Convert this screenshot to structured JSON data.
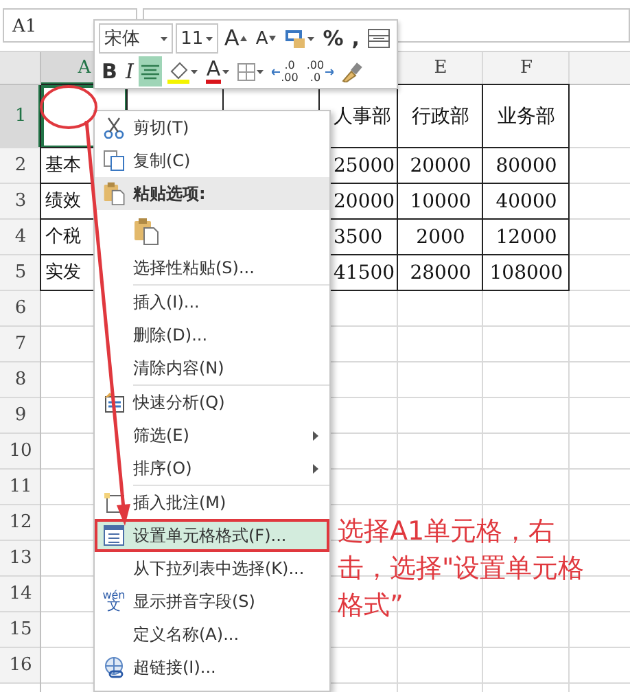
{
  "name_box": {
    "value": "A1"
  },
  "column_headers": {
    "a": {
      "label": "A",
      "selected": true
    },
    "e": {
      "label": "E",
      "selected": false
    },
    "f": {
      "label": "F",
      "selected": false
    }
  },
  "rows": [
    {
      "header": "1",
      "selected": true,
      "d": "人事部",
      "e": "行政部",
      "f": "业务部"
    },
    {
      "header": "2",
      "selected": false,
      "a": "基本",
      "d": "25000",
      "e": "20000",
      "f": "80000"
    },
    {
      "header": "3",
      "selected": false,
      "a": "绩效",
      "d": "20000",
      "e": "10000",
      "f": "40000"
    },
    {
      "header": "4",
      "selected": false,
      "a": "个税",
      "d": "3500",
      "e": "2000",
      "f": "12000"
    },
    {
      "header": "5",
      "selected": false,
      "a": "实发",
      "d": "41500",
      "e": "28000",
      "f": "108000"
    },
    {
      "header": "6",
      "selected": false
    },
    {
      "header": "7",
      "selected": false
    },
    {
      "header": "8",
      "selected": false
    },
    {
      "header": "9",
      "selected": false
    },
    {
      "header": "10",
      "selected": false
    },
    {
      "header": "11",
      "selected": false
    },
    {
      "header": "12",
      "selected": false
    },
    {
      "header": "13",
      "selected": false
    },
    {
      "header": "14",
      "selected": false
    },
    {
      "header": "15",
      "selected": false
    },
    {
      "header": "16",
      "selected": false
    }
  ],
  "mini_toolbar": {
    "top_row": [
      {
        "kind": "font",
        "text": "宋体"
      },
      {
        "kind": "size",
        "text": "11"
      },
      {
        "kind": "grow",
        "text": "A"
      },
      {
        "kind": "shrink",
        "text": "A"
      },
      {
        "kind": "accounting"
      },
      {
        "kind": "text",
        "text": "%"
      },
      {
        "kind": "text",
        "text": ","
      },
      {
        "kind": "style"
      }
    ],
    "bottom_row": [
      {
        "kind": "bold",
        "text": "B"
      },
      {
        "kind": "italic",
        "text": "I"
      },
      {
        "kind": "align",
        "selected": true
      },
      {
        "kind": "fill"
      },
      {
        "kind": "fontcolor",
        "text": "A"
      },
      {
        "kind": "borders"
      },
      {
        "kind": "inc",
        "top": ".0",
        "bottom": ".00"
      },
      {
        "kind": "dec",
        "top": ".00",
        "bottom": ".0"
      },
      {
        "kind": "painter"
      }
    ]
  },
  "menu": {
    "items": [
      {
        "kind": "cut",
        "label": "剪切(T)",
        "selected": false,
        "boxed": false
      },
      {
        "kind": "copy",
        "label": "复制(C)",
        "selected": false,
        "boxed": false
      },
      {
        "kind": "heading",
        "label": "粘贴选项:"
      },
      {
        "kind": "paste"
      },
      {
        "kind": "plain",
        "label": "选择性粘贴(S)...",
        "selected": false,
        "boxed": false
      },
      {
        "kind": "separator"
      },
      {
        "kind": "plain",
        "label": "插入(I)...",
        "selected": false,
        "boxed": false
      },
      {
        "kind": "plain",
        "label": "删除(D)...",
        "selected": false,
        "boxed": false
      },
      {
        "kind": "plain",
        "label": "清除内容(N)",
        "selected": false,
        "boxed": false
      },
      {
        "kind": "separator"
      },
      {
        "kind": "analysis",
        "label": "快速分析(Q)",
        "selected": false,
        "boxed": false
      },
      {
        "kind": "submenu",
        "label": "筛选(E)",
        "selected": false,
        "boxed": false
      },
      {
        "kind": "submenu",
        "label": "排序(O)",
        "selected": false,
        "boxed": false
      },
      {
        "kind": "separator"
      },
      {
        "kind": "comment",
        "label": "插入批注(M)",
        "selected": false,
        "boxed": false
      },
      {
        "kind": "format",
        "label": "设置单元格格式(F)...",
        "selected": true,
        "boxed": true
      },
      {
        "kind": "plain",
        "label": "从下拉列表中选择(K)...",
        "selected": false,
        "boxed": false
      },
      {
        "kind": "pinyin",
        "label": "显示拼音字段(S)",
        "icon_text": [
          "wén",
          "文"
        ],
        "selected": false,
        "boxed": false
      },
      {
        "kind": "plain",
        "label": "定义名称(A)...",
        "selected": false,
        "boxed": false
      },
      {
        "kind": "link",
        "label": "超链接(I)...",
        "selected": false,
        "boxed": false
      }
    ]
  },
  "annotation": {
    "text": "选择A1单元格，右击，选择\"设置单元格格式”",
    "circle": true,
    "arrow": true
  }
}
